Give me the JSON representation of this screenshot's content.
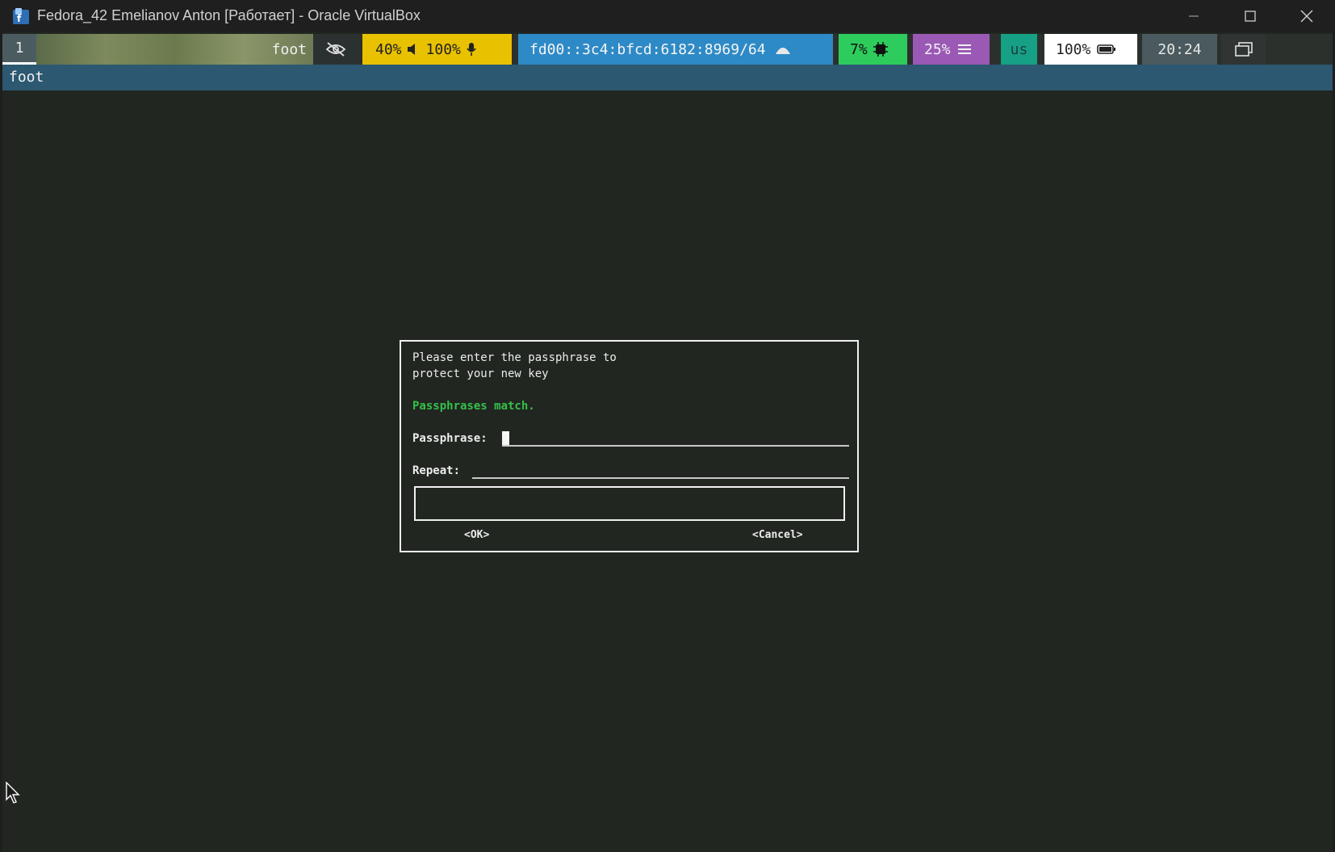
{
  "host": {
    "title": "Fedora_42 Emelianov Anton [Работает] - Oracle VirtualBox",
    "icons": {
      "app": "virtualbox-icon",
      "minimize": "minimize-icon",
      "maximize": "maximize-icon",
      "close": "close-icon"
    }
  },
  "bar": {
    "workspace": "1",
    "window": "foot",
    "audio_volume": "40%",
    "mic_volume": "100%",
    "network": "fd00::3c4:bfcd:6182:8969/64",
    "cpu": "7%",
    "memory": "25%",
    "language": "us",
    "battery": "100%",
    "clock": "20:24"
  },
  "window_title": "foot",
  "dialog": {
    "prompt_line1": "Please enter the passphrase to",
    "prompt_line2": "protect your new key",
    "status": "Passphrases match.",
    "passphrase_label": "Passphrase:",
    "repeat_label": "Repeat:",
    "ok_label": "<OK>",
    "cancel_label": "<Cancel>"
  },
  "colors": {
    "terminal_bg": "#212621",
    "match_status": "#35c04a",
    "title_bar": "#2c5871"
  }
}
